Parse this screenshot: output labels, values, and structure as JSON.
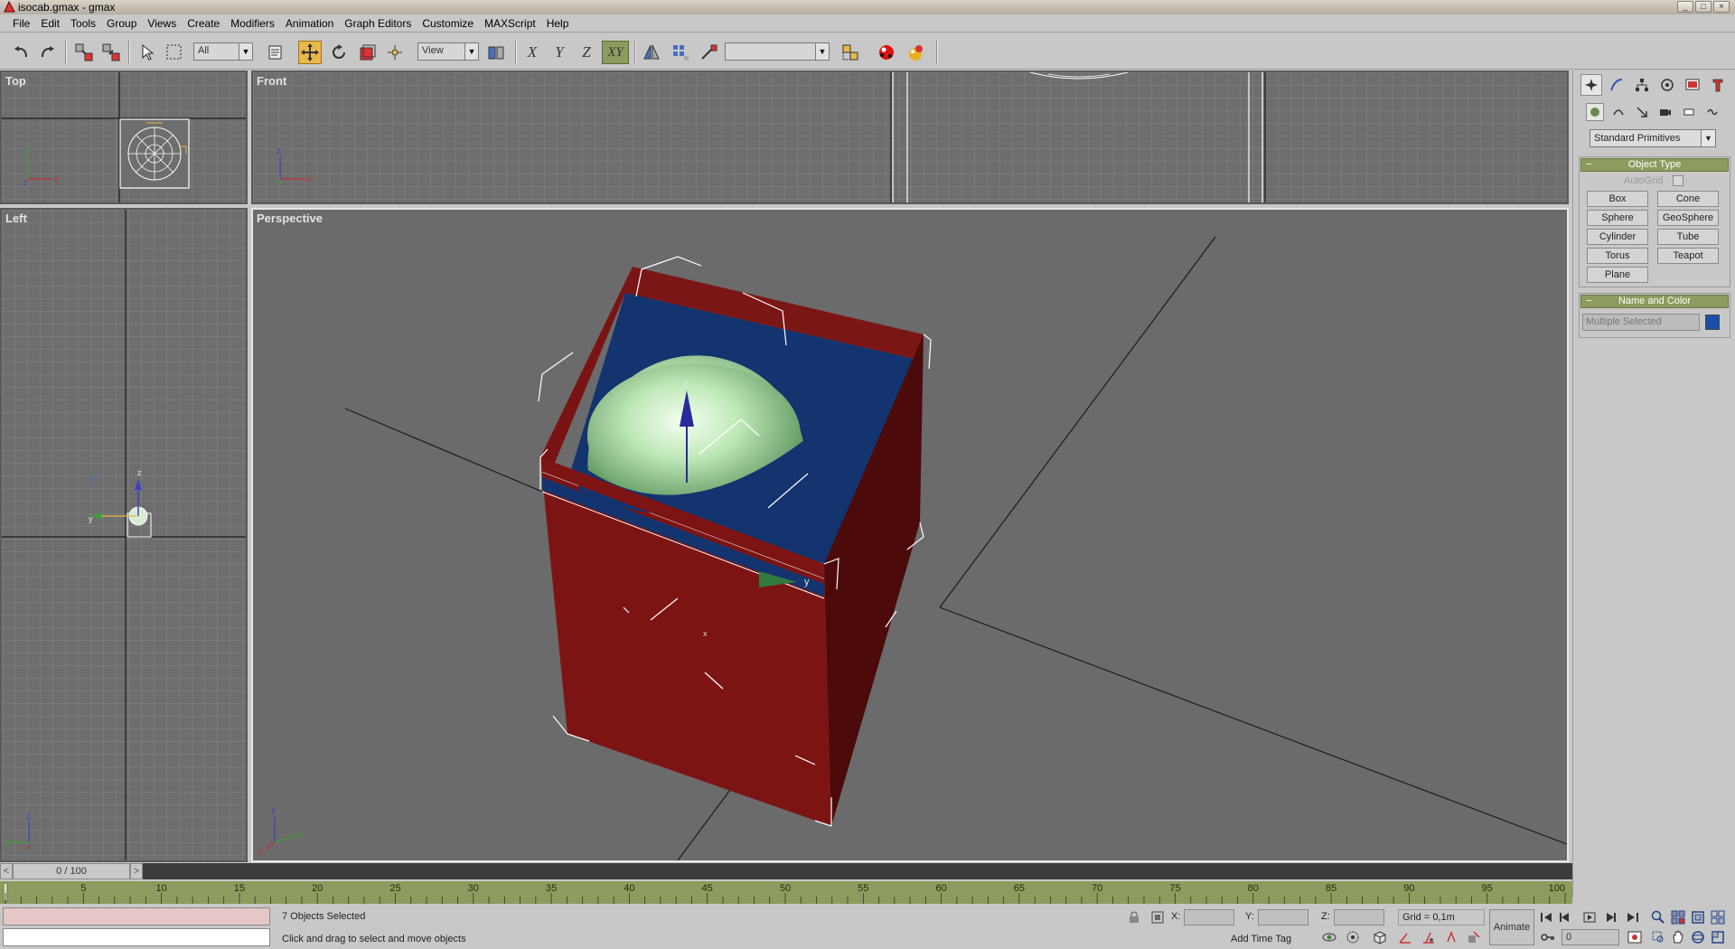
{
  "window": {
    "title": "isocab.gmax - gmax"
  },
  "menu": [
    {
      "label": "File"
    },
    {
      "label": "Edit"
    },
    {
      "label": "Tools"
    },
    {
      "label": "Group"
    },
    {
      "label": "Views"
    },
    {
      "label": "Create"
    },
    {
      "label": "Modifiers"
    },
    {
      "label": "Animation"
    },
    {
      "label": "Graph Editors"
    },
    {
      "label": "Customize"
    },
    {
      "label": "MAXScript"
    },
    {
      "label": "Help"
    }
  ],
  "toolbar": {
    "selection_filter": "All",
    "reference_coord": "View",
    "axis_x": "X",
    "axis_y": "Y",
    "axis_z": "Z",
    "axis_xy": "XY",
    "named_selection": ""
  },
  "viewports": {
    "top": {
      "label": "Top"
    },
    "front": {
      "label": "Front"
    },
    "left": {
      "label": "Left"
    },
    "perspective": {
      "label": "Perspective"
    }
  },
  "command_panel": {
    "category": "Standard Primitives",
    "object_type_title": "Object Type",
    "autogrid_label": "AutoGrid",
    "buttons": [
      "Box",
      "Cone",
      "Sphere",
      "GeoSphere",
      "Cylinder",
      "Tube",
      "Torus",
      "Teapot",
      "Plane"
    ],
    "name_color_title": "Name and Color",
    "name_value": "Multiple Selected",
    "object_color": "#1a4fa8"
  },
  "timeline": {
    "frame_indicator": "0 / 100",
    "ticks": [
      "5",
      "10",
      "15",
      "20",
      "25",
      "30",
      "35",
      "40",
      "45",
      "50",
      "55",
      "60",
      "65",
      "70",
      "75",
      "80",
      "85",
      "90",
      "95",
      "100"
    ]
  },
  "status": {
    "selection": "7 Objects Selected",
    "prompt": "Click and drag to select and move objects",
    "x_label": "X:",
    "y_label": "Y:",
    "z_label": "Z:",
    "grid": "Grid = 0,1m",
    "add_time_tag": "Add Time Tag",
    "animate": "Animate",
    "current_frame": "0"
  },
  "colors": {
    "cabinet_red": "#8a1a1a",
    "cabinet_blue": "#13346e",
    "sphere_green": "#b8e6b0",
    "trackbar_green": "#8d9c5e",
    "active_tool": "#e8b84a"
  }
}
